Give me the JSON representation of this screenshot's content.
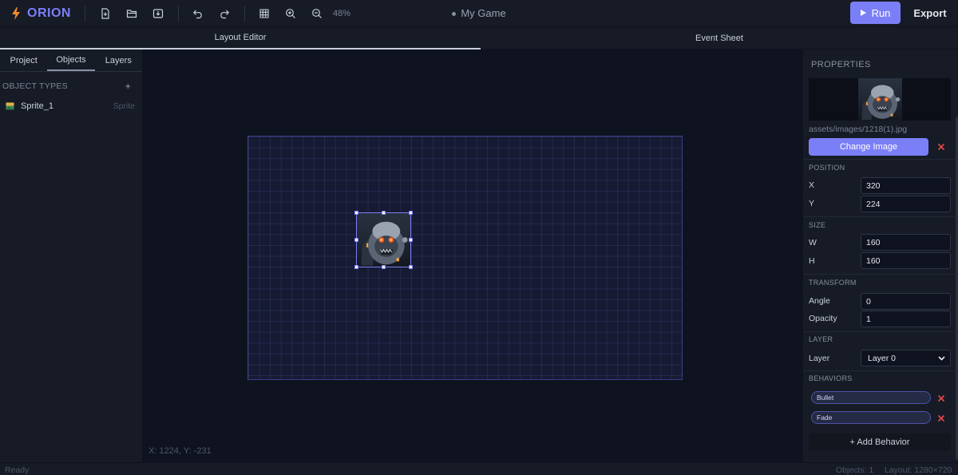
{
  "app": {
    "name": "ORION",
    "project_title": "My Game"
  },
  "toolbar": {
    "zoom_label": "48%",
    "run_label": "Run",
    "export_label": "Export"
  },
  "view_tabs": [
    {
      "label": "Layout Editor",
      "active": true
    },
    {
      "label": "Event Sheet",
      "active": false
    }
  ],
  "left_panel": {
    "tabs": [
      {
        "label": "Project"
      },
      {
        "label": "Objects",
        "active": true
      },
      {
        "label": "Layers"
      }
    ],
    "section_title": "OBJECT TYPES",
    "add_label": "+",
    "objects": [
      {
        "name": "Sprite_1",
        "type": "Sprite"
      }
    ]
  },
  "canvas": {
    "coords": "X: 1224, Y: -231"
  },
  "properties": {
    "title": "PROPERTIES",
    "image_path": "assets/images/1218(1).jpg",
    "change_image_label": "Change Image",
    "position": {
      "section": "POSITION",
      "x_label": "X",
      "x": "320",
      "y_label": "Y",
      "y": "224"
    },
    "size": {
      "section": "SIZE",
      "w_label": "W",
      "w": "160",
      "h_label": "H",
      "h": "160"
    },
    "transform": {
      "section": "TRANSFORM",
      "angle_label": "Angle",
      "angle": "0",
      "opacity_label": "Opacity",
      "opacity": "1"
    },
    "layer": {
      "section": "LAYER",
      "label": "Layer",
      "value": "Layer 0"
    },
    "behaviors": {
      "section": "BEHAVIORS",
      "items": [
        "Bullet",
        "Fade"
      ],
      "add_label": "+ Add Behavior"
    }
  },
  "status": {
    "left": "Ready",
    "objects": "Objects: 1",
    "layout": "Layout: 1280×720"
  },
  "colors": {
    "accent": "#7b7ff7",
    "brand_bolt": "#f28b2c",
    "danger": "#e5484d",
    "background": "#0f1320",
    "panel": "#161b26"
  }
}
